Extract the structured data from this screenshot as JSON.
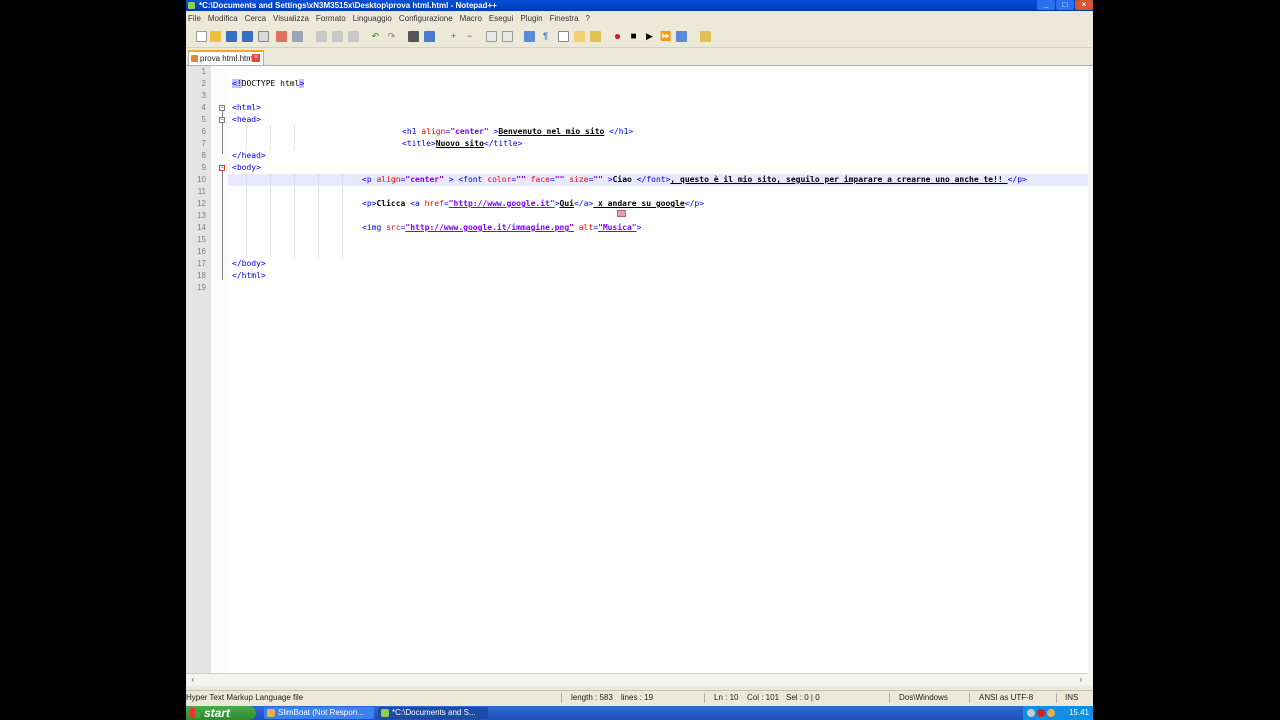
{
  "window": {
    "title": "*C:\\Documents and Settings\\xN3M3515x\\Desktop\\prova html.html - Notepad++",
    "buttons": [
      "_",
      "□",
      "×"
    ]
  },
  "menu": [
    "File",
    "Modifica",
    "Cerca",
    "Visualizza",
    "Formato",
    "Linguaggio",
    "Configurazione",
    "Macro",
    "Esegui",
    "Plugin",
    "Finestra",
    "?"
  ],
  "tab": {
    "label": "prova html.html",
    "close": "×"
  },
  "editor": {
    "line_numbers": [
      "1",
      "2",
      "3",
      "4",
      "5",
      "6",
      "7",
      "8",
      "9",
      "10",
      "11",
      "12",
      "13",
      "14",
      "15",
      "16",
      "17",
      "18",
      "19"
    ],
    "current_line": 10
  },
  "code": {
    "l2": {
      "open": "<!",
      "doctype": "DOCTYPE html",
      "close": ">"
    },
    "l4": "<html>",
    "l5": "<head>",
    "l6": {
      "tag1": "<h1  ",
      "attr1": "align",
      "eq": "=",
      "val1": "\"center\"",
      "close1": "      >",
      "text": "Benvenuto nel mio sito",
      "tag2": " </h1>"
    },
    "l7": {
      "tag1": "<title>",
      "text": "Nuovo sito",
      "tag2": "</title>"
    },
    "l8": "</head>",
    "l9": "<body>",
    "l10": {
      "tag1": "<p ",
      "attr1": "align",
      "eq1": "=",
      "val1": "\"center\"",
      "close1": "  >   ",
      "tag2": "<font  ",
      "attr2": "color",
      "eq2": "=",
      "val2": "\"\"",
      "attr3": " face",
      "eq3": "=",
      "val3": "\"\"",
      "attr4": " size",
      "eq4": "=",
      "val4": "\"\"",
      "close2": "      >",
      "text1": "Ciao ",
      "tag3": "</font>",
      "text2": ", questo è il mio sito, seguilo per imparare a crearne uno anche te!! ",
      "tag4": "</p>"
    },
    "l12": {
      "tag1": "<p>",
      "text1": "Clicca ",
      "tag2": "<a ",
      "attr1": "href",
      "eq": "=",
      "val1": "\"http://www.google.it\"",
      "close1": ">",
      "text2": "Qui",
      "tag3": "</a>",
      "text3": " x andare su google",
      "tag4": "</p>"
    },
    "l14": {
      "tag1": "<img ",
      "attr1": "src",
      "eq1": "=",
      "val1": "\"http://www.google.it/immagine.png\"",
      "attr2": " alt",
      "eq2": "=",
      "val2": "\"Musica\"",
      "close": ">"
    },
    "l17": "</body>",
    "l18": "</html>"
  },
  "status": {
    "filetype": "Hyper Text Markup Language file",
    "length": "length : 583",
    "lines": "lines : 19",
    "ln": "Ln : 10",
    "col": "Col : 101",
    "sel": "Sel : 0 | 0",
    "eol": "Dos\\Windows",
    "encoding": "ANSI as UTF-8",
    "mode": "INS"
  },
  "taskbar": {
    "start": "start",
    "items": [
      "SlimBoat (Not Respon...",
      "*C:\\Documents and S..."
    ],
    "clock": "15.41"
  },
  "colors": {
    "tag": "#0000ff",
    "attr": "#ff0000",
    "value": "#8000ff",
    "titlebar": "#0a4fd8",
    "taskbar": "#3168d5",
    "start": "#3a9a3a"
  }
}
